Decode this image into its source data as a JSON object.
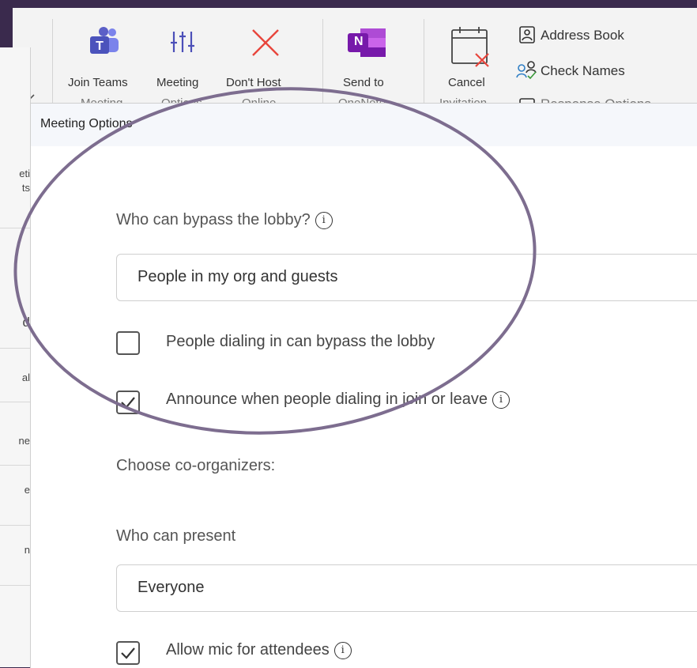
{
  "ribbon": {
    "join_teams": "Join Teams",
    "join_teams_line2": "Meeting",
    "meeting_options": "Meeting",
    "meeting_options_line2": "Options",
    "dont_host": "Don't Host",
    "dont_host_line2": "Online",
    "send_to": "Send to",
    "send_to_line2": "OneNote",
    "cancel": "Cancel",
    "cancel_line2": "Invitation",
    "address_book": "Address Book",
    "check_names": "Check Names",
    "response_options": "Response Options",
    "onenote_letter": "N"
  },
  "left_panel": {
    "items": [
      "eti",
      "ts",
      "d",
      "al",
      "ne",
      "e",
      "n"
    ]
  },
  "dialog": {
    "title": "Meeting Options",
    "lobby_label": "Who can bypass the lobby?",
    "lobby_value": "People in my org and guests",
    "dialin_bypass_label": "People dialing in can bypass the lobby",
    "dialin_bypass_checked": false,
    "announce_label": "Announce when people dialing in join or leave",
    "announce_checked": true,
    "coorganizers_label": "Choose co-organizers:",
    "present_label": "Who can present",
    "present_value": "Everyone",
    "allow_mic_label": "Allow mic for attendees",
    "allow_mic_checked": true
  },
  "icons": {
    "info": "info-icon",
    "teams": "teams-icon",
    "meeting_options": "sliders-icon",
    "dont_host": "close-x-icon",
    "onenote": "onenote-icon",
    "cancel": "calendar-cancel-icon",
    "address_book": "address-book-icon",
    "check_names": "check-names-icon"
  },
  "colors": {
    "teams_purple": "#5b5fc7",
    "onenote_purple": "#7719aa",
    "dont_host_red": "#e8453c",
    "annotation": "#7d6d8f",
    "frame": "#3a2a4d"
  }
}
